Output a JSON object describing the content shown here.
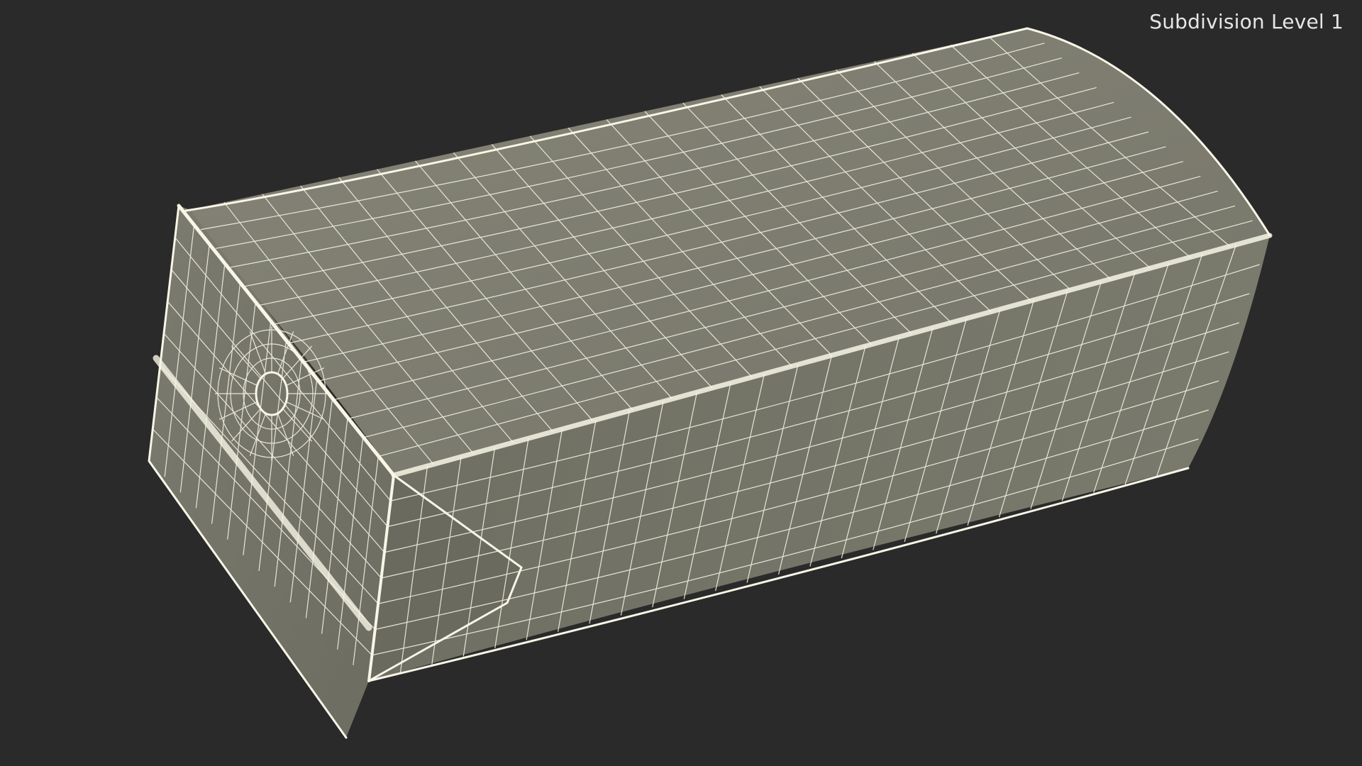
{
  "viewport": {
    "label": "Subdivision Level 1",
    "background_color": "#2a2a2a"
  },
  "model": {
    "render_style": "wireframe-on-shaded",
    "surface_color": "#7b7b6e",
    "wire_color": "#f2f0e0"
  }
}
